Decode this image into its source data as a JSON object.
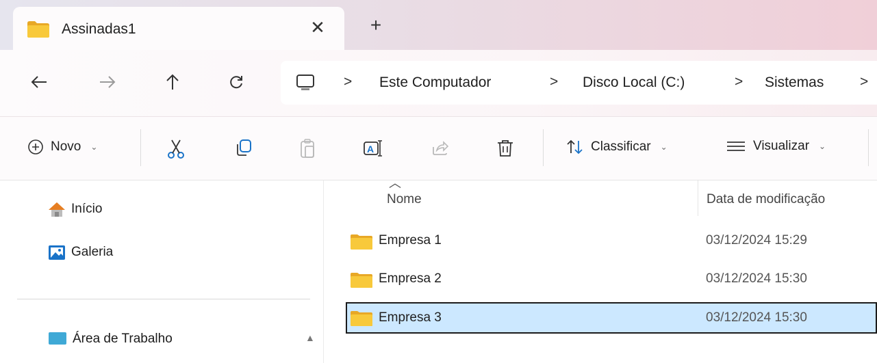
{
  "tab": {
    "title": "Assinadas1",
    "close_glyph": "✕",
    "new_tab_glyph": "+",
    "icon": "folder-icon"
  },
  "nav": {
    "back_icon": "arrow-left-icon",
    "forward_icon": "arrow-right-icon",
    "up_icon": "arrow-up-icon",
    "refresh_icon": "refresh-icon",
    "breadcrumb": [
      "Este Computador",
      "Disco Local (C:)",
      "Sistemas"
    ],
    "separator": ">"
  },
  "toolbar": {
    "new_label": "Novo",
    "sort_label": "Classificar",
    "view_label": "Visualizar",
    "icons": [
      "cut-icon",
      "copy-icon",
      "paste-icon",
      "rename-icon",
      "share-icon",
      "delete-icon"
    ]
  },
  "sidebar": {
    "items": [
      {
        "label": "Início",
        "icon": "home-icon"
      },
      {
        "label": "Galeria",
        "icon": "gallery-icon"
      }
    ],
    "partial_item": {
      "label": "Área de Trabalho",
      "icon": "desktop-icon"
    }
  },
  "filelist": {
    "columns": {
      "name": "Nome",
      "date": "Data de modificação"
    },
    "rows": [
      {
        "name": "Empresa 1",
        "date": "03/12/2024 15:29",
        "selected": false
      },
      {
        "name": "Empresa 2",
        "date": "03/12/2024 15:30",
        "selected": false
      },
      {
        "name": "Empresa 3",
        "date": "03/12/2024 15:30",
        "selected": true
      }
    ]
  },
  "colors": {
    "folder": "#f8c93b",
    "selection": "#cce8ff"
  }
}
